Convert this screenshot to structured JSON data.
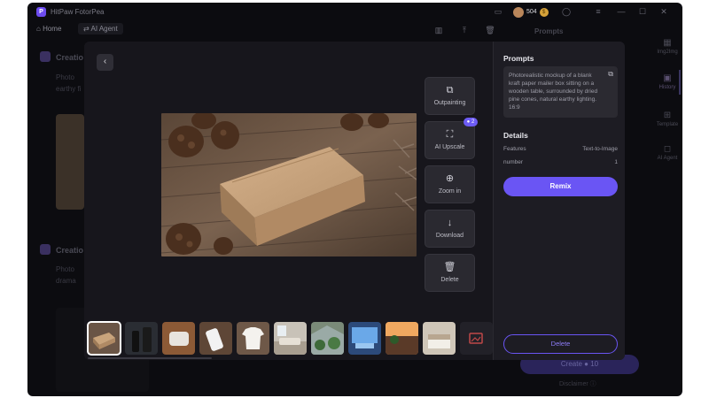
{
  "app": {
    "title": "HitPaw FotorPea",
    "logo_letter": "P",
    "credits": "504",
    "coin_symbol": "$"
  },
  "nav": {
    "home_label": "Home",
    "agent_label": "AI Agent"
  },
  "background": {
    "card1_title": "Creatio",
    "card1_text1": "Photo",
    "card1_text2": "earthy fi",
    "card2_title": "Creatio",
    "card2_text1": "Photo",
    "card2_text2": "drama",
    "prompts_heading": "Prompts",
    "create_label": "Create",
    "create_cost": "10",
    "disclaimer_label": "Disclaimer"
  },
  "rail": [
    {
      "label": "Img2Img",
      "icon": "image-stack-icon"
    },
    {
      "label": "History",
      "icon": "history-icon",
      "active": true
    },
    {
      "label": "Template",
      "icon": "template-icon"
    },
    {
      "label": "AI Agent",
      "icon": "agent-icon"
    }
  ],
  "modal": {
    "tools": [
      {
        "label": "Outpainting",
        "icon": "outpainting-icon"
      },
      {
        "label": "AI Upscale",
        "icon": "upscale-icon",
        "badge": "2"
      },
      {
        "label": "Zoom in",
        "icon": "zoom-in-icon"
      },
      {
        "label": "Download",
        "icon": "download-icon"
      },
      {
        "label": "Delete",
        "icon": "trash-icon"
      }
    ],
    "prompts_title": "Prompts",
    "prompt_text": "Photorealistic mockup of a blank kraft paper mailer box sitting on a wooden table, surrounded by dried pine cones, natural earthy lighting. 16:9",
    "details_title": "Details",
    "details": [
      {
        "key": "Features",
        "value": "Text-to-Image"
      },
      {
        "key": "number",
        "value": "1"
      }
    ],
    "remix_label": "Remix",
    "delete_label": "Delete"
  },
  "colors": {
    "accent": "#6a55f4",
    "modal_bg": "#18171d",
    "app_bg": "#0c0c10"
  }
}
